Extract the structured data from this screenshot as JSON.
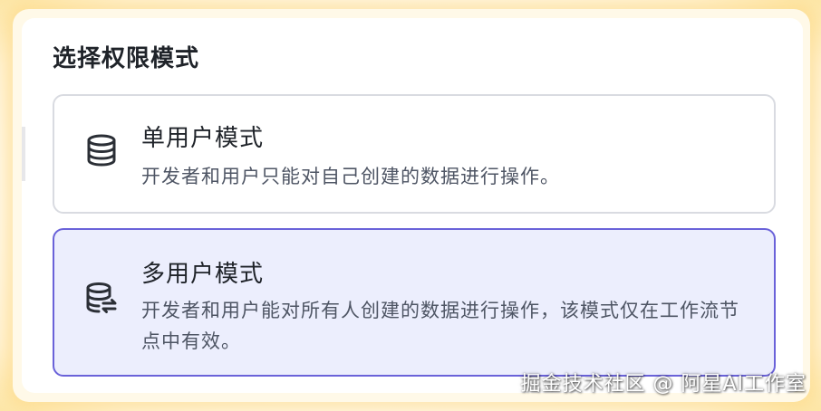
{
  "dialog": {
    "title": "选择权限模式"
  },
  "options": [
    {
      "title": "单用户模式",
      "description": "开发者和用户只能对自己创建的数据进行操作。",
      "icon": "database-icon",
      "selected": false
    },
    {
      "title": "多用户模式",
      "description": "开发者和用户能对所有人创建的数据进行操作，该模式仅在工作流节点中有效。",
      "icon": "database-sync-icon",
      "selected": true
    }
  ],
  "watermark": "掘金技术社区 @ 阿星AI工作室",
  "colors": {
    "selected_border": "#6a62d9",
    "selected_background": "#eceefd",
    "default_border": "#d9dbe1",
    "glow": "#fde7a8"
  }
}
